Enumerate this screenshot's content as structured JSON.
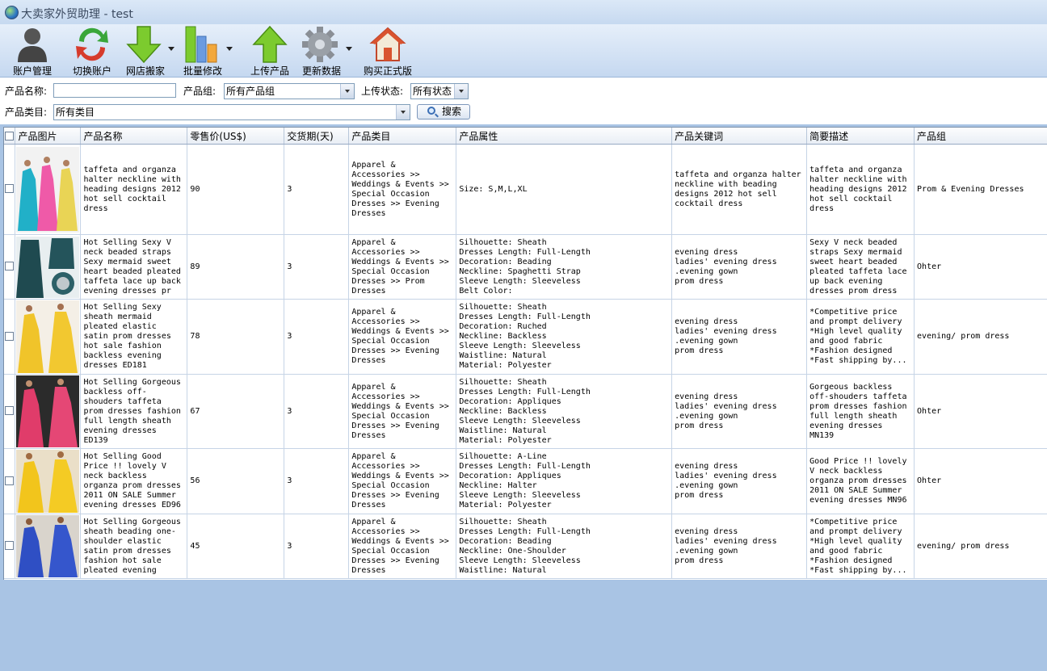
{
  "window": {
    "title": "大卖家外贸助理 - test"
  },
  "toolbar": [
    {
      "label": "账户管理",
      "icon": "person-icon"
    },
    {
      "label": "切换账户",
      "icon": "switch-arrows-icon"
    },
    {
      "label": "网店搬家",
      "icon": "download-arrow-icon"
    },
    {
      "label": "批量修改",
      "icon": "bar-chart-icon"
    },
    {
      "label": "上传产品",
      "icon": "upload-arrow-icon"
    },
    {
      "label": "更新数据",
      "icon": "gear-icon"
    },
    {
      "label": "购买正式版",
      "icon": "house-icon"
    }
  ],
  "filters": {
    "name_label": "产品名称:",
    "name_value": "",
    "group_label": "产品组:",
    "group_value": "所有产品组",
    "status_label": "上传状态:",
    "status_value": "所有状态",
    "category_label": "产品类目:",
    "category_value": "所有类目",
    "search_label": "搜索"
  },
  "table": {
    "columns": [
      "产品图片",
      "产品名称",
      "零售价(US$)",
      "交货期(天)",
      "产品类目",
      "产品属性",
      "产品关键词",
      "简要描述",
      "产品组"
    ],
    "rows": [
      {
        "name": "taffeta and organza halter neckline with heading  designs 2012  hot sell cocktail dress",
        "price": "90",
        "delivery": "3",
        "category": "Apparel & Accessories >> Weddings & Events >> Special Occasion Dresses >> Evening Dresses",
        "attributes": "Size: S,M,L,XL",
        "keywords": "taffeta and organza halter neckline with beading designs 2012  hot sell cocktail dress",
        "description": "taffeta and organza halter neckline with heading  designs 2012  hot sell cocktail dress",
        "group": "Prom & Evening Dresses"
      },
      {
        "name": "Hot Selling Sexy V neck beaded straps Sexy mermaid sweet heart beaded pleated taffeta lace up back evening dresses pr",
        "price": "89",
        "delivery": "3",
        "category": "Apparel & Accessories >> Weddings & Events >> Special Occasion Dresses >> Prom Dresses",
        "attributes": "Silhouette: Sheath\nDresses Length: Full-Length\nDecoration: Beading\nNeckline: Spaghetti Strap\nSleeve Length: Sleeveless\nBelt Color:",
        "keywords": "evening dress\nladies' evening dress\n.evening gown\nprom dress",
        "description": "Sexy V neck beaded straps Sexy mermaid sweet heart beaded pleated taffeta lace up back evening dresses prom dress",
        "group": "Ohter"
      },
      {
        "name": "Hot Selling Sexy sheath mermaid pleated elastic satin prom dresses hot sale fashion backless evening dresses ED181",
        "price": "78",
        "delivery": "3",
        "category": "Apparel & Accessories >> Weddings & Events >> Special Occasion Dresses >> Evening Dresses",
        "attributes": "Silhouette: Sheath\nDresses Length: Full-Length\nDecoration: Ruched\nNeckline: Backless\nSleeve Length: Sleeveless\nWaistline: Natural\nMaterial: Polyester",
        "keywords": "evening dress\nladies' evening dress\n.evening gown\nprom dress",
        "description": "*Competitive price\nand prompt delivery\n*High level quality\nand good fabric\n*Fashion designed\n*Fast shipping by...",
        "group": "evening/ prom dress"
      },
      {
        "name": "Hot Selling Gorgeous backless off-shouders taffeta prom dresses fashion full length sheath evening dresses ED139",
        "price": "67",
        "delivery": "3",
        "category": "Apparel & Accessories >> Weddings & Events >> Special Occasion Dresses >> Evening Dresses",
        "attributes": "Silhouette: Sheath\nDresses Length: Full-Length\nDecoration: Appliques\nNeckline: Backless\nSleeve Length: Sleeveless\nWaistline: Natural\nMaterial: Polyester",
        "keywords": "evening dress\nladies' evening dress\n.evening gown\nprom dress",
        "description": "Gorgeous backless off-shouders taffeta prom dresses fashion full length sheath evening dresses MN139",
        "group": "Ohter"
      },
      {
        "name": "Hot Selling Good Price !! lovely V neck backless organza prom dresses 2011 ON SALE Summer evening dresses ED96",
        "price": "56",
        "delivery": "3",
        "category": "Apparel & Accessories >> Weddings & Events >> Special Occasion Dresses >> Evening Dresses",
        "attributes": "Silhouette: A-Line\nDresses Length: Full-Length\nDecoration: Appliques\nNeckline: Halter\nSleeve Length: Sleeveless\nMaterial: Polyester",
        "keywords": "evening dress\nladies' evening dress\n.evening gown\nprom dress",
        "description": "Good Price !! lovely V neck backless organza prom dresses 2011 ON SALE Summer evening dresses MN96",
        "group": "Ohter"
      },
      {
        "name": "Hot Selling Gorgeous sheath beading one-shoulder elastic satin prom dresses fashion hot sale pleated evening",
        "price": "45",
        "delivery": "3",
        "category": "Apparel & Accessories >> Weddings & Events >> Special Occasion Dresses >> Evening Dresses",
        "attributes": "Silhouette: Sheath\nDresses Length: Full-Length\nDecoration: Beading\nNeckline: One-Shoulder\nSleeve Length: Sleeveless\nWaistline: Natural",
        "keywords": "evening dress\nladies' evening dress\n.evening gown\nprom dress",
        "description": "*Competitive price\nand prompt delivery\n*High level quality\nand good fabric\n*Fashion designed\n*Fast shipping by...",
        "group": "evening/ prom dress"
      }
    ]
  },
  "colors": {
    "accent": "#3c6fb5",
    "frame": "#a9c4e4"
  }
}
